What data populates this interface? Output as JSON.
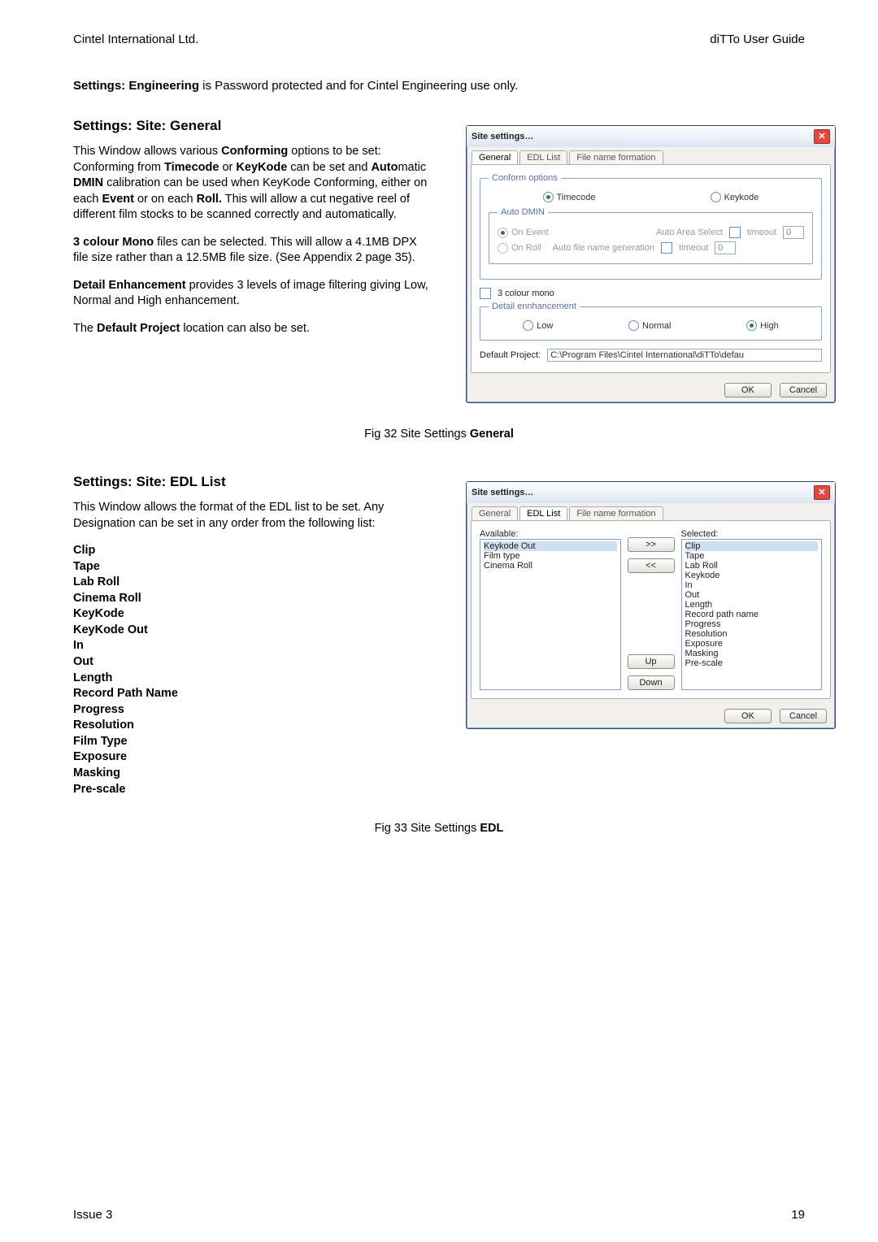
{
  "header": {
    "company": "Cintel International Ltd.",
    "doc": "diTTo User Guide"
  },
  "engline": {
    "title": "Settings: Engineering",
    "rest": " is Password protected and for Cintel Engineering use only."
  },
  "section1": {
    "title": "Settings: Site: General",
    "p1a": "This Window allows various ",
    "p1b": "Conforming",
    "p1c": " options to be set: Conforming from ",
    "p1d": "Timecode",
    "p1e": " or ",
    "p1f": "KeyKode",
    "p1g": " can be set and ",
    "p1h": "Auto",
    "p1i": "matic ",
    "p1j": "DMIN",
    "p1k": " calibration can be used when KeyKode Conforming, either on each ",
    "p1l": "Event",
    "p1m": " or on each ",
    "p1n": "Roll.",
    "p1o": " This will allow a cut negative reel of different film stocks to be scanned correctly and automatically.",
    "p2a": "3 colour Mono",
    "p2b": " files can be selected. This will allow a 4.1MB DPX file size rather than a 12.5MB file size. (See Appendix 2 page 35).",
    "p3a": "Detail Enhancement",
    "p3b": " provides 3 levels of image filtering giving Low, Normal and High enhancement.",
    "p4a": "The ",
    "p4b": "Default Project",
    "p4c": " location can also be set."
  },
  "dlg1": {
    "title": "Site settings…",
    "tabs": {
      "general": "General",
      "edl": "EDL List",
      "file": "File name formation"
    },
    "conform_legend": "Conform options",
    "timecode": "Timecode",
    "keykode": "Keykode",
    "autodmin_legend": "Auto DMIN",
    "onevent": "On Event",
    "onroll": "On Roll",
    "autoarea": "Auto Area Select",
    "autofile": "Auto file name generation",
    "timeout": "timeout",
    "timeout_v": "0",
    "three_mono": "3 colour mono",
    "detail_legend": "Detail ennhancement",
    "low": "Low",
    "normal": "Normal",
    "high": "High",
    "defproj_lbl": "Default Project:",
    "defproj_val": "C:\\Program Files\\Cintel International\\diTTo\\defau",
    "ok": "OK",
    "cancel": "Cancel"
  },
  "cap1a": "Fig 32 Site Settings ",
  "cap1b": "General",
  "section2": {
    "title": "Settings: Site: EDL List",
    "p1": "This Window allows the format of the EDL list to be set.  Any Designation can be set in any order from the following list:",
    "list": [
      "Clip",
      "Tape",
      "Lab Roll",
      "Cinema Roll",
      "KeyKode",
      "KeyKode Out",
      "In",
      "Out",
      "Length",
      "Record Path Name",
      "Progress",
      "Resolution",
      "Film Type",
      "Exposure",
      "Masking",
      "Pre-scale"
    ]
  },
  "dlg2": {
    "title": "Site settings…",
    "available_lbl": "Available:",
    "selected_lbl": "Selected:",
    "available": [
      "Keykode Out",
      "Film type",
      "Cinema Roll"
    ],
    "selected": [
      "Clip",
      "Tape",
      "Lab Roll",
      "Keykode",
      "In",
      "Out",
      "Length",
      "Record path name",
      "Progress",
      "Resolution",
      "Exposure",
      "Masking",
      "Pre-scale"
    ],
    "add": ">>",
    "remove": "<<",
    "up": "Up",
    "down": "Down",
    "ok": "OK",
    "cancel": "Cancel"
  },
  "cap2a": "Fig 33 Site Settings ",
  "cap2b": "EDL",
  "footer": {
    "issue": "Issue 3",
    "page": "19"
  }
}
